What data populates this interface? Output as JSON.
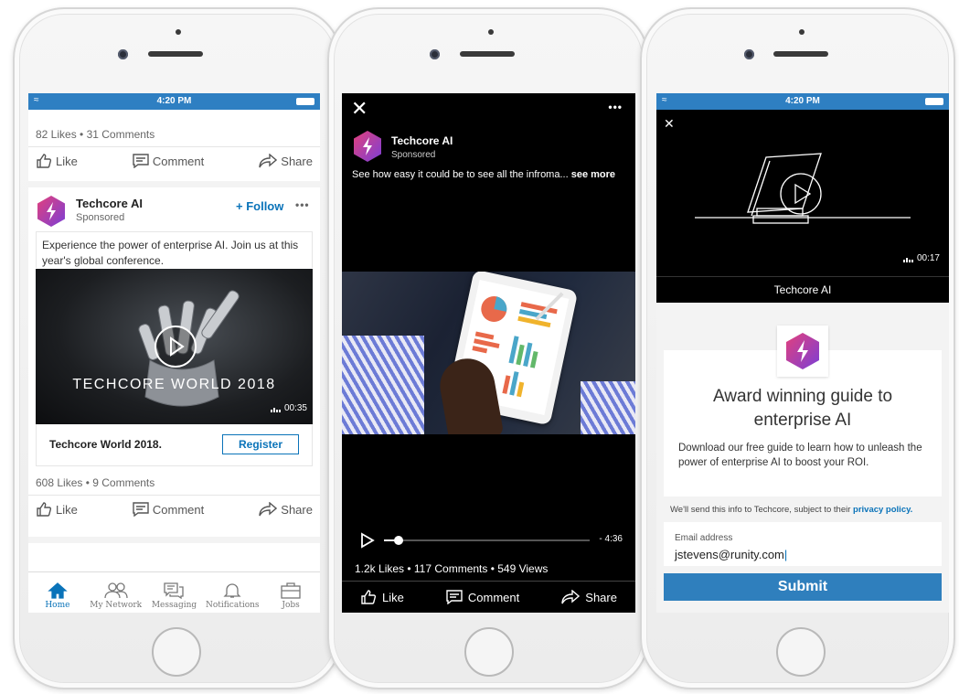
{
  "status_time": "4:20 PM",
  "feed": {
    "prev_post": {
      "stats": "82 Likes • 31 Comments"
    },
    "actions": {
      "like": "Like",
      "comment": "Comment",
      "share": "Share"
    },
    "ad": {
      "company": "Techcore AI",
      "sponsored": "Sponsored",
      "follow": "+ Follow",
      "more": "•••",
      "body": "Experience the power of enterprise AI. Join us at this year's global conference.",
      "video_overlay": "TECHCORE WORLD 2018",
      "duration": "00:35",
      "cta_title": "Techcore World 2018.",
      "cta_button": "Register",
      "stats": "608 Likes • 9 Comments"
    },
    "nav": [
      {
        "label": "Home",
        "icon": "home-icon"
      },
      {
        "label": "My Network",
        "icon": "network-icon"
      },
      {
        "label": "Messaging",
        "icon": "messaging-icon"
      },
      {
        "label": "Notifications",
        "icon": "bell-icon"
      },
      {
        "label": "Jobs",
        "icon": "briefcase-icon"
      }
    ]
  },
  "video_view": {
    "company": "Techcore AI",
    "sponsored": "Sponsored",
    "caption": "See how easy it could be to see all the infroma...",
    "see_more": "see more",
    "time_remaining": "- 4:36",
    "progress": 0.07,
    "stats": "1.2k Likes • 117 Comments • 549 Views",
    "actions": {
      "like": "Like",
      "comment": "Comment",
      "share": "Share"
    }
  },
  "lead_gen": {
    "duration": "00:17",
    "company": "Techcore AI",
    "headline": "Award winning guide to enterprise AI",
    "description": "Download our free guide to learn how to unleash the power of enterprise AI to boost your ROI.",
    "consent": "We'll send this info to Techcore, subject to their",
    "consent_link": "privacy policy.",
    "email_label": "Email address",
    "email_value": "jstevens@runity.com",
    "submit": "Submit"
  },
  "colors": {
    "brand_blue": "#0a73b9",
    "status_bar": "#2e7fc2",
    "submit_blue": "#2f7fbd",
    "logo_gradient": [
      "#e3407c",
      "#7b3fd6"
    ]
  }
}
